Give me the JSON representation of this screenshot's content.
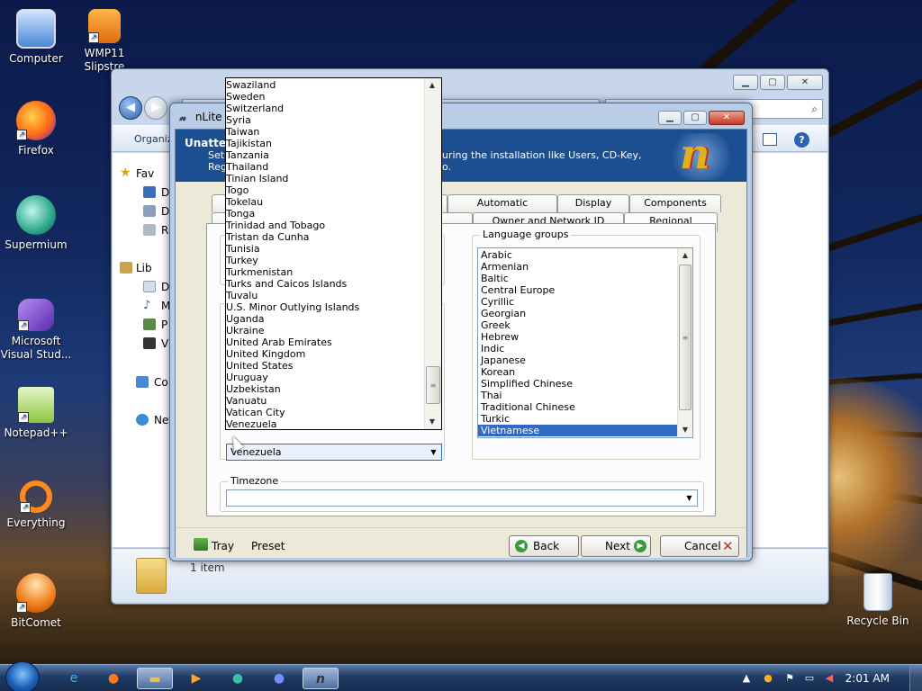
{
  "desktop": {
    "icons": [
      {
        "label": "Computer",
        "icon": "computer-icon"
      },
      {
        "label": "WMP11 Slipstre",
        "icon": "media-player-icon"
      },
      {
        "label": "Firefox",
        "icon": "firefox-icon"
      },
      {
        "label": "Supermium",
        "icon": "supermium-icon"
      },
      {
        "label": "Microsoft Visual Stud...",
        "icon": "visual-studio-icon"
      },
      {
        "label": "Notepad++",
        "icon": "notepad-plus-plus-icon"
      },
      {
        "label": "Everything",
        "icon": "everything-search-icon"
      },
      {
        "label": "BitComet",
        "icon": "bitcomet-icon"
      },
      {
        "label": "Recycle Bin",
        "icon": "recycle-bin-icon"
      }
    ]
  },
  "explorer": {
    "toolbar": {
      "organize": "Organiz"
    },
    "sidebar": [
      {
        "label": "Fav",
        "icon": "star-icon"
      },
      {
        "label": "D",
        "icon": "desktop-icon"
      },
      {
        "label": "D",
        "icon": "downloads-icon"
      },
      {
        "label": "R",
        "icon": "recent-places-icon"
      },
      {
        "label": "Lib",
        "icon": "libraries-icon"
      },
      {
        "label": "D",
        "icon": "documents-icon"
      },
      {
        "label": "M",
        "icon": "music-icon"
      },
      {
        "label": "P",
        "icon": "pictures-icon"
      },
      {
        "label": "V",
        "icon": "videos-icon"
      },
      {
        "label": "Co",
        "icon": "computer-icon"
      },
      {
        "label": "Net",
        "icon": "network-icon"
      }
    ],
    "status": {
      "item_count": "1 item"
    }
  },
  "nlite": {
    "title": "nLite",
    "banner": {
      "heading": "Unatten",
      "desc_line1": "Set",
      "desc_line2": "Reg",
      "desc_right1": "uring the installation like Users, CD-Key,",
      "desc_right2": "o."
    },
    "tabs_back": [
      "Automatic Updates",
      "Display",
      "Components"
    ],
    "tabs_front": [
      "Owner and Network ID",
      "Regional"
    ],
    "active_tab": "Regional",
    "language_groups": {
      "legend": "Language groups",
      "items": [
        "Arabic",
        "Armenian",
        "Baltic",
        "Central Europe",
        "Cyrillic",
        "Georgian",
        "Greek",
        "Hebrew",
        "Indic",
        "Japanese",
        "Korean",
        "Simplified Chinese",
        "Thai",
        "Traditional Chinese",
        "Turkic",
        "Vietnamese"
      ],
      "selected": "Vietnamese"
    },
    "country": {
      "selected": "Venezuela",
      "dropdown_items": [
        "Swaziland",
        "Sweden",
        "Switzerland",
        "Syria",
        "Taiwan",
        "Tajikistan",
        "Tanzania",
        "Thailand",
        "Tinian Island",
        "Togo",
        "Tokelau",
        "Tonga",
        "Trinidad and Tobago",
        "Tristan da Cunha",
        "Tunisia",
        "Turkey",
        "Turkmenistan",
        "Turks and Caicos Islands",
        "Tuvalu",
        "U.S. Minor Outlying Islands",
        "Uganda",
        "Ukraine",
        "United Arab Emirates",
        "United Kingdom",
        "United States",
        "Uruguay",
        "Uzbekistan",
        "Vanuatu",
        "Vatican City",
        "Venezuela"
      ]
    },
    "timezone": {
      "legend": "Timezone",
      "value": ""
    },
    "bottom": {
      "tray": "Tray",
      "preset": "Preset",
      "back": "Back",
      "next": "Next",
      "cancel": "Cancel"
    }
  },
  "taskbar": {
    "clock": "2:01 AM",
    "apps": [
      "internet-explorer-icon",
      "firefox-icon",
      "explorer-folder-icon",
      "media-player-icon",
      "supermium-icon",
      "firefox-alt-icon",
      "nlite-icon"
    ]
  }
}
